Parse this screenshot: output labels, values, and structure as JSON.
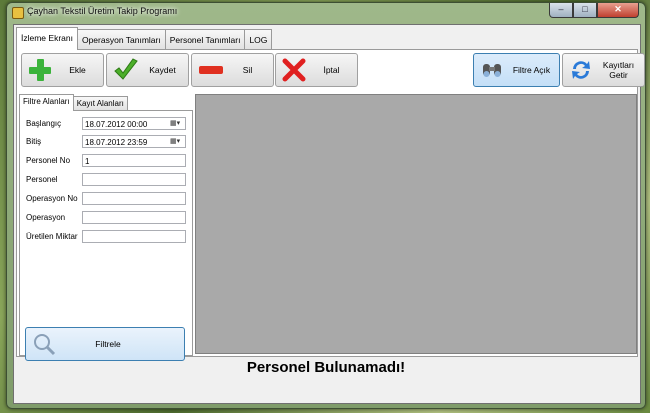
{
  "window": {
    "title": "Çayhan Tekstil Üretim Takip Programı",
    "minimize": "–",
    "maximize": "□",
    "close": "✕"
  },
  "tabs": [
    "İzleme Ekranı",
    "Operasyon Tanımları",
    "Personel Tanımları",
    "LOG"
  ],
  "toolbar": {
    "add": "Ekle",
    "save": "Kaydet",
    "delete": "Sil",
    "cancel": "İptal",
    "filter": "Filtre Açık",
    "load": "Kayıtları Getir"
  },
  "subtabs": [
    "Filtre Alanları",
    "Kayıt Alanları"
  ],
  "filters": {
    "start_label": "Başlangıç",
    "start_value": "18.07.2012 00:00",
    "end_label": "Bitiş",
    "end_value": "18.07.2012 23:59",
    "personel_no_label": "Personel No",
    "personel_no_value": "1",
    "personel_label": "Personel",
    "personel_value": "",
    "operasyon_no_label": "Operasyon No",
    "operasyon_no_value": "",
    "operasyon_label": "Operasyon",
    "operasyon_value": "",
    "miktar_label": "Üretilen Miktar",
    "miktar_value": ""
  },
  "filter_button": "Filtrele",
  "status_message": "Personel Bulunamadı!",
  "colors": {
    "add": "#3bb33b",
    "save": "#4caf2a",
    "delete": "#e03020",
    "cancel": "#e02020",
    "grid": "#a9a9a9"
  },
  "icons": {
    "add": "plus-icon",
    "save": "checkmark-icon",
    "delete": "minus-icon",
    "cancel": "x-icon",
    "filter": "binoculars-icon",
    "load": "refresh-icon",
    "search": "magnifier-icon"
  }
}
